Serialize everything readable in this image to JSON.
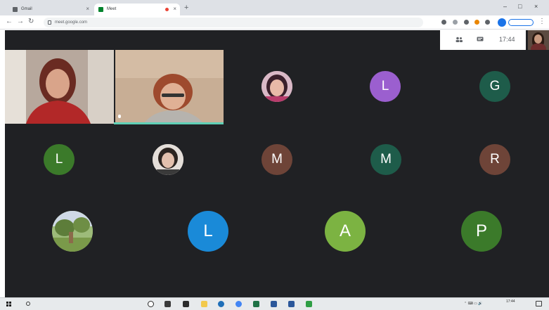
{
  "browser": {
    "tabs": [
      {
        "label": "Gmail"
      },
      {
        "label": "Meet"
      }
    ],
    "new_tab_glyph": "+",
    "window_controls": [
      "–",
      "□",
      "×"
    ],
    "address": "meet.google.com",
    "profile_pill": ""
  },
  "meet": {
    "clock": "17:44",
    "icons": [
      "people-icon",
      "chat-icon"
    ]
  },
  "participants": {
    "row1": [
      {
        "type": "video",
        "name": ""
      },
      {
        "type": "video",
        "name": ""
      },
      {
        "type": "photo",
        "color": "#c9a5b3"
      },
      {
        "type": "initial",
        "initial": "L",
        "color": "#9b5fcf"
      },
      {
        "type": "initial",
        "initial": "G",
        "color": "#1e5c4a"
      }
    ],
    "row2": [
      {
        "type": "initial",
        "initial": "L",
        "color": "#3b7a2a"
      },
      {
        "type": "photo",
        "color": "#d9d3cf"
      },
      {
        "type": "initial",
        "initial": "M",
        "color": "#6e4438"
      },
      {
        "type": "initial",
        "initial": "M",
        "color": "#1e5c4a"
      },
      {
        "type": "initial",
        "initial": "R",
        "color": "#6e4438"
      }
    ],
    "row3": [
      {
        "type": "photo",
        "color": "#7f9a58"
      },
      {
        "type": "initial",
        "initial": "L",
        "color": "#1a8ad8"
      },
      {
        "type": "initial",
        "initial": "A",
        "color": "#7cb342"
      },
      {
        "type": "initial",
        "initial": "P",
        "color": "#3b7a2a"
      }
    ]
  },
  "taskbar": {
    "search_placeholder": "",
    "clock": "17:44"
  }
}
